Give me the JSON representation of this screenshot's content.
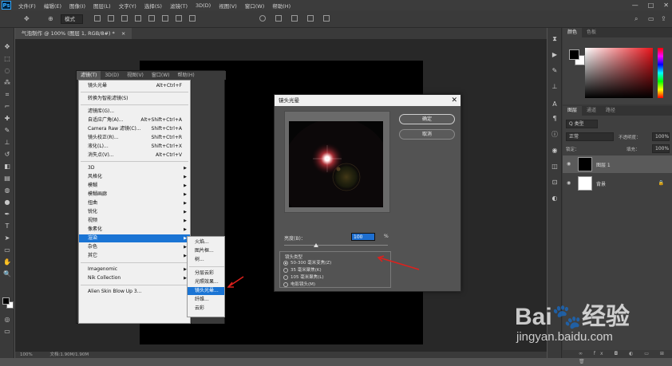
{
  "app": {
    "logo": "Ps"
  },
  "menubar": {
    "items": [
      "文件(F)",
      "编辑(E)",
      "图像(I)",
      "图层(L)",
      "文字(Y)",
      "选择(S)",
      "滤镜(T)",
      "3D(D)",
      "视图(V)",
      "窗口(W)",
      "帮助(H)"
    ],
    "win_controls": [
      "—",
      "□",
      "✕"
    ]
  },
  "options": {
    "mode_label": "模式",
    "arrows": [
      "⊕",
      "▾"
    ]
  },
  "document": {
    "tab_title": "气泡制作 @ 100% (图层 1, RGB/8#) *",
    "tab_close": "×"
  },
  "status": {
    "zoom": "100%",
    "info": "文档:1.90M/1.90M"
  },
  "filter_menu": {
    "menubar": [
      "滤镜(T)",
      "3D(D)",
      "视图(V)",
      "窗口(W)",
      "帮助(H)"
    ],
    "items": [
      {
        "label": "镜头光晕",
        "shortcut": "Alt+Ctrl+F"
      },
      {
        "label": "转换为智能滤镜(S)",
        "shortcut": ""
      },
      {
        "label": "滤镜库(G)...",
        "shortcut": ""
      },
      {
        "label": "自适应广角(A)...",
        "shortcut": "Alt+Shift+Ctrl+A"
      },
      {
        "label": "Camera Raw 滤镜(C)...",
        "shortcut": "Shift+Ctrl+A"
      },
      {
        "label": "镜头校正(R)...",
        "shortcut": "Shift+Ctrl+R"
      },
      {
        "label": "液化(L)...",
        "shortcut": "Shift+Ctrl+X"
      },
      {
        "label": "消失点(V)...",
        "shortcut": "Alt+Ctrl+V"
      },
      {
        "label": "3D"
      },
      {
        "label": "风格化"
      },
      {
        "label": "模糊"
      },
      {
        "label": "模糊画廊"
      },
      {
        "label": "扭曲"
      },
      {
        "label": "锐化"
      },
      {
        "label": "视频"
      },
      {
        "label": "像素化"
      },
      {
        "label": "渲染"
      },
      {
        "label": "杂色"
      },
      {
        "label": "其它"
      },
      {
        "label": "Imagenomic"
      },
      {
        "label": "Nik Collection"
      },
      {
        "label": "Alien Skin Blow Up 3..."
      }
    ],
    "highlighted": "渲染"
  },
  "render_submenu": {
    "items": [
      "火焰...",
      "图片框...",
      "树...",
      "分层云彩",
      "光照效果...",
      "镜头光晕...",
      "纤维...",
      "云彩"
    ],
    "highlighted": "镜头光晕..."
  },
  "dialog": {
    "title": "镜头光晕",
    "close": "✕",
    "ok": "确定",
    "cancel": "取消",
    "brightness_label": "亮度(B)：",
    "brightness_value": "100",
    "brightness_unit": "%",
    "brightness_percent": 100,
    "lens_group_title": "镜头类型",
    "lens_options": [
      "50-300 毫米变焦(Z)",
      "35 毫米聚焦(K)",
      "105 毫米聚焦(L)",
      "电影镜头(M)"
    ],
    "lens_selected": 0
  },
  "color_panel": {
    "tabs": [
      "颜色",
      "色板"
    ],
    "fg": "#000000",
    "bg": "#ffffff",
    "hue": "#e8141b"
  },
  "layers_panel": {
    "tabs": [
      "图层",
      "通道",
      "路径"
    ],
    "kind_label": "Q 类型",
    "blend_mode": "正常",
    "opacity_label": "不透明度：",
    "opacity": "100%",
    "lock_label": "锁定：",
    "fill_label": "填充：",
    "fill": "100%",
    "layers": [
      {
        "name": "图层 1",
        "thumb": "#000000",
        "selected": true
      },
      {
        "name": "背景",
        "thumb": "#ffffff",
        "selected": false
      }
    ],
    "footer": "∞ fx ◘ ◐ ▭ ⊞ 🗑"
  },
  "watermark": {
    "logo": "Bai🐾经验",
    "url": "jingyan.baidu.com"
  },
  "icons": {
    "move": "✥",
    "marquee": "⬚",
    "lasso": "◌",
    "wand": "⁂",
    "crop": "⌗",
    "eyedropper": "⌐",
    "heal": "✚",
    "brush": "✎",
    "stamp": "⊥",
    "history": "↺",
    "eraser": "◧",
    "gradient": "▤",
    "blur": "◍",
    "dodge": "●",
    "pen": "✒",
    "text": "T",
    "path": "➤",
    "shape": "▭",
    "hand": "✋",
    "zoom": "🔍"
  }
}
